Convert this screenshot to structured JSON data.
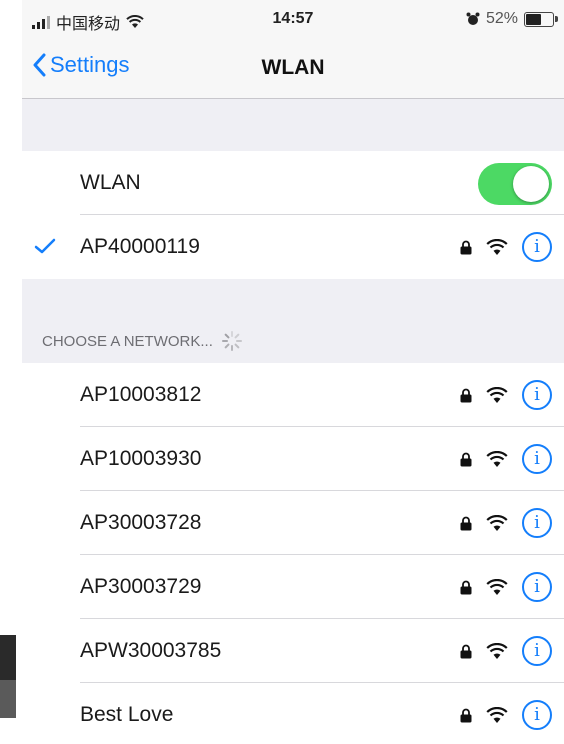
{
  "status_bar": {
    "carrier": "中国移动",
    "time": "14:57",
    "battery_percent": "52%",
    "battery_level": 0.52
  },
  "nav": {
    "back_label": "Settings",
    "title": "WLAN"
  },
  "wlan_toggle": {
    "label": "WLAN",
    "on": true
  },
  "connected": {
    "name": "AP40000119"
  },
  "section_header": "CHOOSE A NETWORK...",
  "networks": [
    {
      "name": "AP10003812"
    },
    {
      "name": "AP10003930"
    },
    {
      "name": "AP30003728"
    },
    {
      "name": "AP30003729"
    },
    {
      "name": "APW30003785"
    },
    {
      "name": "Best Love"
    }
  ],
  "colors": {
    "accent": "#147efb",
    "toggle_on": "#4cd964",
    "background": "#efeff4"
  },
  "icons": [
    "signal-icon",
    "wifi-icon",
    "alarm-icon",
    "battery-icon",
    "back-chevron-icon",
    "checkmark-icon",
    "lock-icon",
    "info-icon",
    "spinner-icon"
  ]
}
